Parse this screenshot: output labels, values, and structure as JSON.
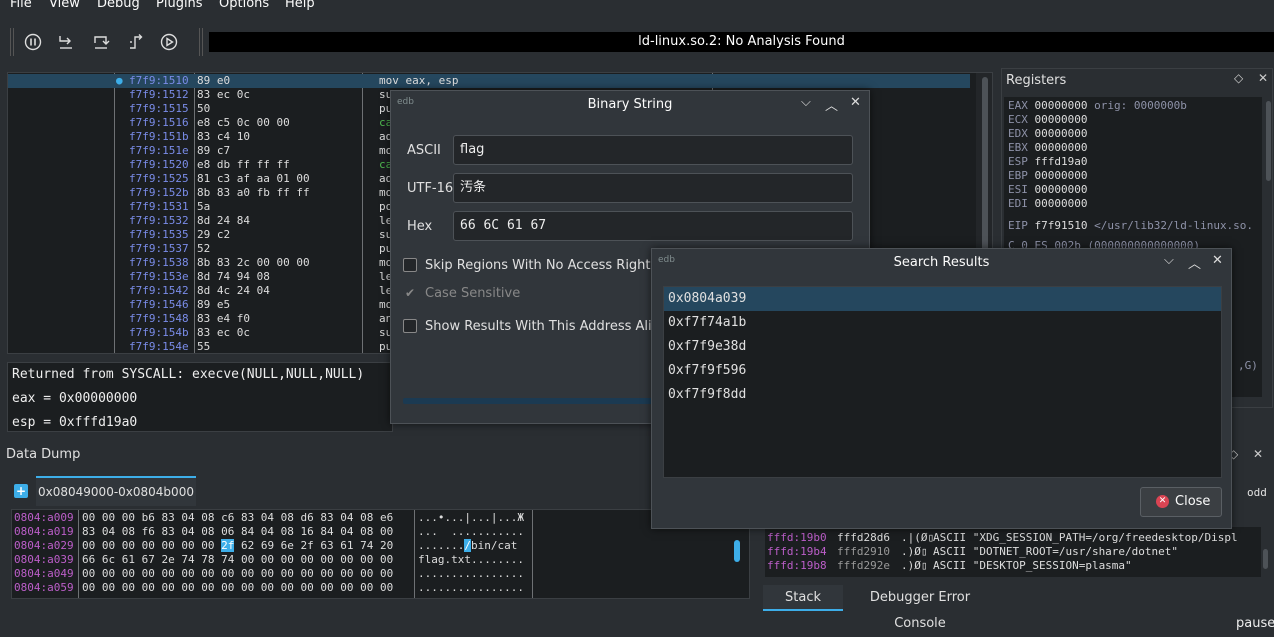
{
  "menu": [
    "File",
    "View",
    "Debug",
    "Plugins",
    "Options",
    "Help"
  ],
  "toolbar": {
    "icons": [
      "pause-icon",
      "step-into-icon",
      "step-over-icon",
      "step-out-icon",
      "run-icon"
    ]
  },
  "analysis_status": "ld-linux.so.2: No Analysis Found",
  "code": {
    "rows": [
      {
        "addr": "f7f9:1510",
        "bytes": "89 e0",
        "ins": "mov eax, esp",
        "current": true
      },
      {
        "addr": "f7f9:1512",
        "bytes": "83 ec 0c",
        "ins": "su"
      },
      {
        "addr": "f7f9:1515",
        "bytes": "50",
        "ins": "pu"
      },
      {
        "addr": "f7f9:1516",
        "bytes": "e8 c5 0c 00 00",
        "ins": "ca",
        "green": true
      },
      {
        "addr": "f7f9:151b",
        "bytes": "83 c4 10",
        "ins": "ad"
      },
      {
        "addr": "f7f9:151e",
        "bytes": "89 c7",
        "ins": "mo"
      },
      {
        "addr": "f7f9:1520",
        "bytes": "e8 db ff ff ff",
        "ins": "ca",
        "green": true
      },
      {
        "addr": "f7f9:1525",
        "bytes": "81 c3 af aa 01 00",
        "ins": "ad"
      },
      {
        "addr": "f7f9:152b",
        "bytes": "8b 83 a0 fb ff ff",
        "ins": "mo"
      },
      {
        "addr": "f7f9:1531",
        "bytes": "5a",
        "ins": "po"
      },
      {
        "addr": "f7f9:1532",
        "bytes": "8d 24 84",
        "ins": "le"
      },
      {
        "addr": "f7f9:1535",
        "bytes": "29 c2",
        "ins": "su"
      },
      {
        "addr": "f7f9:1537",
        "bytes": "52",
        "ins": "pu"
      },
      {
        "addr": "f7f9:1538",
        "bytes": "8b 83 2c 00 00 00",
        "ins": "mo"
      },
      {
        "addr": "f7f9:153e",
        "bytes": "8d 74 94 08",
        "ins": "le"
      },
      {
        "addr": "f7f9:1542",
        "bytes": "8d 4c 24 04",
        "ins": "le"
      },
      {
        "addr": "f7f9:1546",
        "bytes": "89 e5",
        "ins": "mo"
      },
      {
        "addr": "f7f9:1548",
        "bytes": "83 e4 f0",
        "ins": "an"
      },
      {
        "addr": "f7f9:154b",
        "bytes": "83 ec 0c",
        "ins": "su"
      },
      {
        "addr": "f7f9:154e",
        "bytes": "55",
        "ins": "pu"
      }
    ]
  },
  "info": {
    "line1": "Returned from SYSCALL: execve(NULL,NULL,NULL)",
    "line2": "eax = 0x00000000",
    "line3": "esp = 0xfffd19a0"
  },
  "registers": {
    "title": "Registers",
    "rows": [
      {
        "name": "EAX",
        "value": "00000000",
        "comment": "orig: 0000000b"
      },
      {
        "name": "ECX",
        "value": "00000000",
        "comment": ""
      },
      {
        "name": "EDX",
        "value": "00000000",
        "comment": ""
      },
      {
        "name": "EBX",
        "value": "00000000",
        "comment": ""
      },
      {
        "name": "ESP",
        "value": "fffd19a0",
        "comment": ""
      },
      {
        "name": "EBP",
        "value": "00000000",
        "comment": ""
      },
      {
        "name": "ESI",
        "value": "00000000",
        "comment": ""
      },
      {
        "name": "EDI",
        "value": "00000000",
        "comment": ""
      }
    ],
    "eip": {
      "name": "EIP",
      "value": "f7f91510",
      "comment": "</usr/lib32/ld-linux.so."
    },
    "partial": "C 0  ES 002b (000000000000000)",
    "partial2": ",G)"
  },
  "datadump": {
    "title": "Data Dump",
    "tab": "0x08049000-0x0804b000",
    "rows": [
      {
        "addr": "0804:a009",
        "hex": "00 00 00 b6 83 04 08 c6 83 04 08 d6 83 04 08 e6",
        "ascii": "...•...|...|...Ж"
      },
      {
        "addr": "0804:a019",
        "hex": "83 04 08 f6 83 04 08 06 84 04 08 16 84 04 08 00",
        "ascii": "...  ..........."
      },
      {
        "addr": "0804:a029",
        "hex_pre": "00 00 00 00 00 00 00 ",
        "hex_hl": "2f",
        "hex_post": " 62 69 6e 2f 63 61 74 20",
        "ascii_pre": ".......",
        "ascii_hl": "/",
        "ascii_post": "bin/cat "
      },
      {
        "addr": "0804:a039",
        "hex": "66 6c 61 67 2e 74 78 74 00 00 00 00 00 00 00 00",
        "ascii": "flag.txt........"
      },
      {
        "addr": "0804:a049",
        "hex": "00 00 00 00 00 00 00 00 00 00 00 00 00 00 00 00",
        "ascii": "................"
      },
      {
        "addr": "0804:a059",
        "hex": "00 00 00 00 00 00 00 00 00 00 00 00 00 00 00 00",
        "ascii": "................"
      }
    ]
  },
  "stack": {
    "odd": "odd",
    "rows": [
      {
        "addr": "fffd:19b0",
        "value": "fffd28d6",
        "chr": ".|(Ø▯",
        "str": "ASCII \"XDG_SESSION_PATH=/org/freedesktop/Displ"
      },
      {
        "addr": "fffd:19b4",
        "value": "fffd2910",
        "chr": ".)Ø▯",
        "str": "ASCII \"DOTNET_ROOT=/usr/share/dotnet\""
      },
      {
        "addr": "fffd:19b8",
        "value": "fffd292e",
        "chr": ".)Ø▯",
        "str": "ASCII \"DESKTOP_SESSION=plasma\""
      }
    ],
    "tabs": [
      "Stack",
      "Debugger Error Console"
    ]
  },
  "status": "paused",
  "binary_dialog": {
    "title": "Binary String",
    "logo": "edb",
    "ascii_label": "ASCII",
    "ascii_value": "flag",
    "utf16_label": "UTF-16",
    "utf16_value": "汚条",
    "hex_label": "Hex",
    "hex_value": "66 6C 61 67",
    "skip_label": "Skip Regions With No Access Rights",
    "case_label": "Case Sensitive",
    "align_label": "Show Results With This Address Alignme"
  },
  "search_dialog": {
    "title": "Search Results",
    "logo": "edb",
    "results": [
      "0x0804a039",
      "0xf7f74a1b",
      "0xf7f9e38d",
      "0xf7f9f596",
      "0xf7f9f8dd"
    ],
    "close_label": "Close"
  }
}
